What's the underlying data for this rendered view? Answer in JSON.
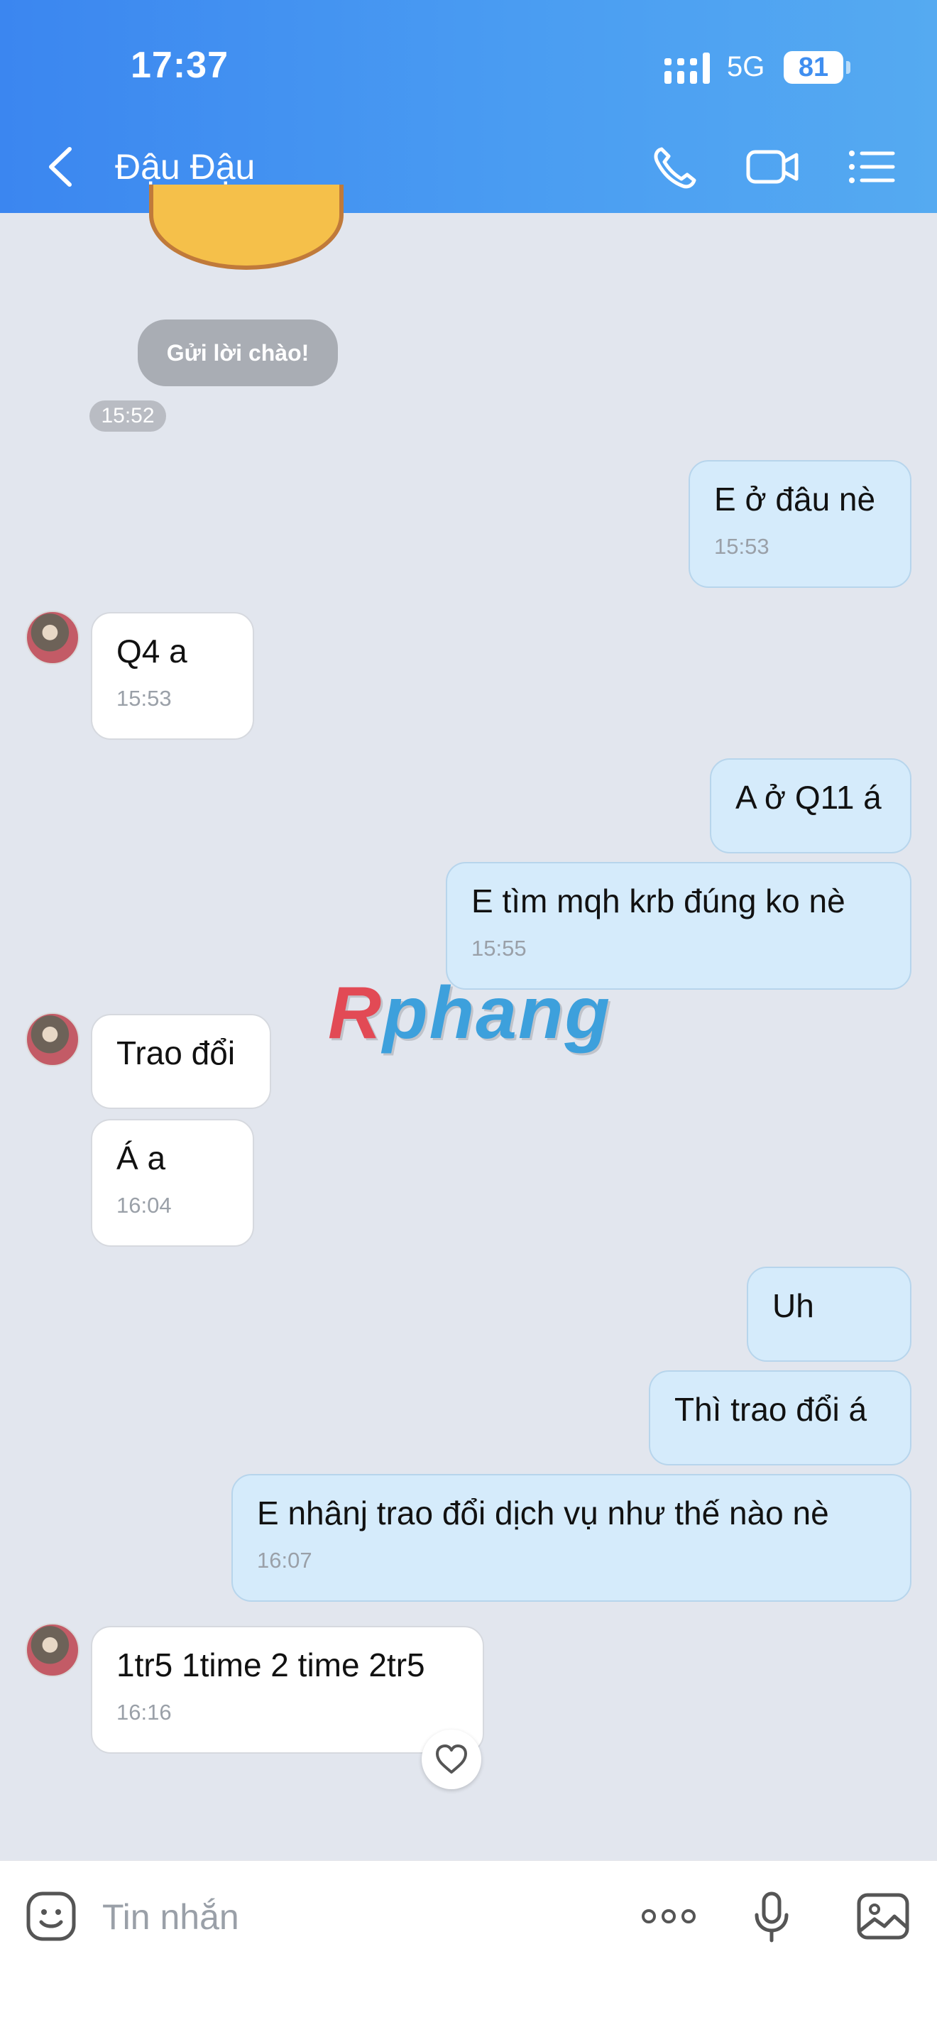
{
  "status_bar": {
    "time": "17:37",
    "network": "5G",
    "battery": "81"
  },
  "header": {
    "title": "Đậu Đậu",
    "icons": [
      "back-chevron-icon",
      "phone-icon",
      "video-call-icon",
      "menu-list-icon"
    ]
  },
  "greeting": {
    "label": "Gửi lời chào!",
    "time": "15:52"
  },
  "messages": [
    {
      "side": "out",
      "text": "E ở đâu nè",
      "time": "15:53"
    },
    {
      "side": "in",
      "text": "Q4 a",
      "time": "15:53"
    },
    {
      "side": "out",
      "text": "A ở Q11 á",
      "time": ""
    },
    {
      "side": "out",
      "text": "E tìm mqh krb đúng ko nè",
      "time": "15:55"
    },
    {
      "side": "in",
      "text": "Trao đổi",
      "time": ""
    },
    {
      "side": "in",
      "text": "Á a",
      "time": "16:04"
    },
    {
      "side": "out",
      "text": "Uh",
      "time": ""
    },
    {
      "side": "out",
      "text": "Thì trao đổi á",
      "time": ""
    },
    {
      "side": "out",
      "text": "E nhânj trao đổi dịch vụ như thế nào nè",
      "time": "16:07"
    },
    {
      "side": "in",
      "text": "1tr5 1time 2 time 2tr5",
      "time": "16:16"
    }
  ],
  "watermark": {
    "prefix": "R",
    "rest": "phang"
  },
  "input_bar": {
    "placeholder": "Tin nhắn",
    "icons": [
      "emoji-sticker-icon",
      "more-dots-icon",
      "voice-mic-icon",
      "image-gallery-icon"
    ]
  },
  "colors": {
    "header_start": "#3b86f0",
    "header_end": "#55aaf1",
    "outgoing_bubble": "#d5ebfb",
    "incoming_bubble": "#ffffff",
    "chat_bg": "#e2e6ee"
  }
}
